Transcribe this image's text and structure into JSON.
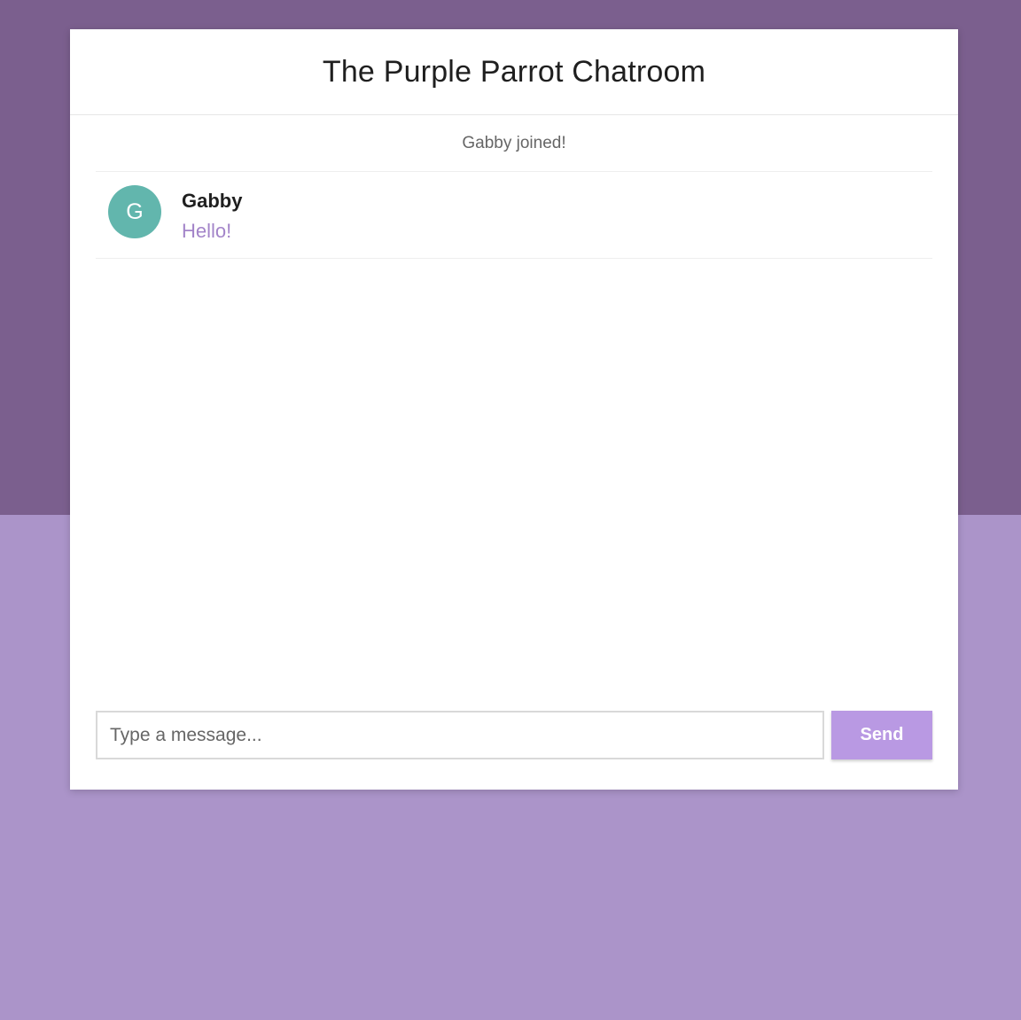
{
  "colors": {
    "background_top": "#7b5f8e",
    "background_bottom": "#ab94c9",
    "card": "#ffffff",
    "avatar": "#62b6ad",
    "message_text": "#a384c9",
    "send_button": "#b999e3"
  },
  "header": {
    "title": "The Purple Parrot Chatroom"
  },
  "messages": {
    "system": "Gabby joined!",
    "items": [
      {
        "avatar_initial": "G",
        "author": "Gabby",
        "text": "Hello!"
      }
    ]
  },
  "composer": {
    "placeholder": "Type a message...",
    "value": "",
    "send_label": "Send"
  }
}
